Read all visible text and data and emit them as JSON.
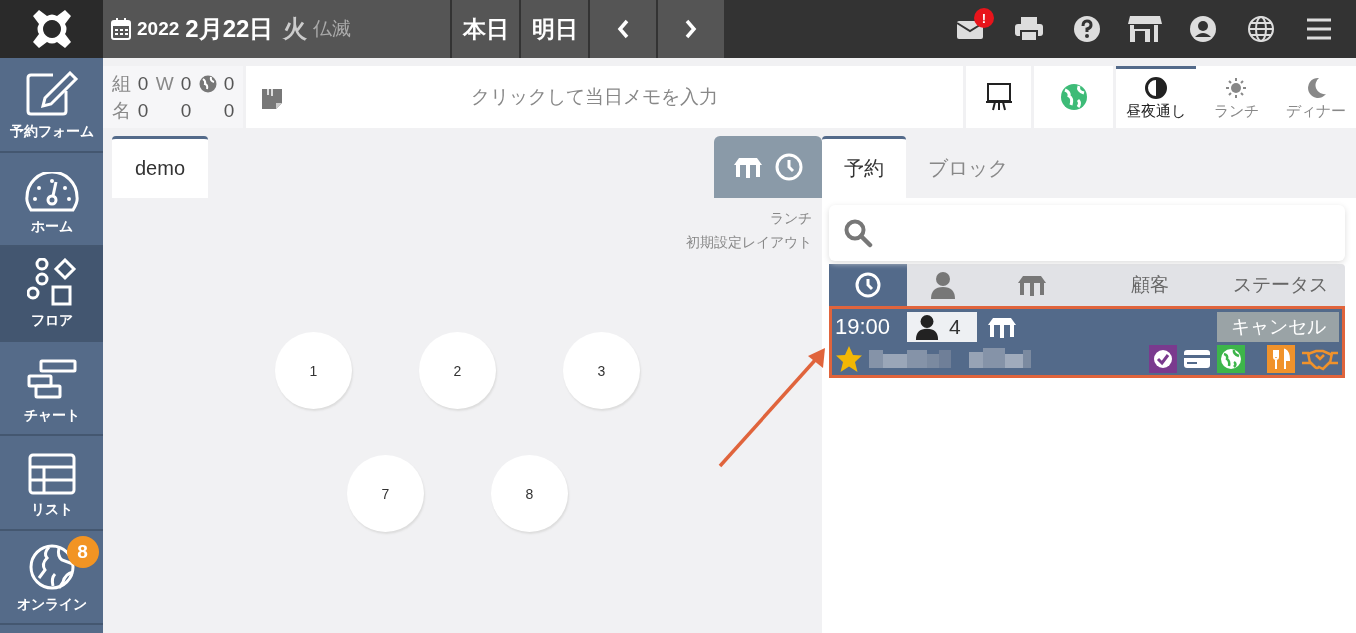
{
  "header": {
    "year": "2022",
    "date": "2月22日",
    "weekday": "火",
    "rokuyo": "仏滅",
    "day_buttons": [
      "本日",
      "明日"
    ],
    "tools": [
      {
        "kind": "mail",
        "badge": "!"
      },
      {
        "kind": "print"
      },
      {
        "kind": "help"
      },
      {
        "kind": "shop"
      },
      {
        "kind": "account"
      },
      {
        "kind": "language"
      },
      {
        "kind": "menu"
      }
    ]
  },
  "sidebar": {
    "items": [
      {
        "label": "予約フォーム",
        "kind": "form",
        "selected": false
      },
      {
        "label": "ホーム",
        "kind": "gauge",
        "selected": false
      },
      {
        "label": "フロア",
        "kind": "floor",
        "selected": true
      },
      {
        "label": "チャート",
        "kind": "chart",
        "selected": false
      },
      {
        "label": "リスト",
        "kind": "list",
        "selected": false
      },
      {
        "label": "オンライン",
        "kind": "online",
        "selected": false,
        "badge": "8"
      }
    ]
  },
  "counts": {
    "w_label": "W",
    "rows": [
      {
        "label": "組",
        "values": [
          "0",
          "0",
          "0"
        ]
      },
      {
        "label": "名",
        "values": [
          "0",
          "0",
          "0"
        ]
      }
    ]
  },
  "memo": {
    "placeholder": "クリックして当日メモを入力"
  },
  "meal_tabs": [
    {
      "label": "昼夜通し",
      "kind": "all",
      "selected": true
    },
    {
      "label": "ランチ",
      "kind": "lunch",
      "selected": false
    },
    {
      "label": "ディナー",
      "kind": "dinner",
      "selected": false
    }
  ],
  "floor": {
    "tabs": [
      {
        "label": "demo",
        "selected": true
      }
    ],
    "period": "ランチ",
    "layout": "初期設定レイアウト",
    "table_rows": [
      [
        "1",
        "2",
        "3"
      ],
      [
        "7",
        "8"
      ]
    ]
  },
  "panel": {
    "tabs": [
      {
        "label": "予約",
        "selected": true
      },
      {
        "label": "ブロック",
        "selected": false
      }
    ],
    "columns": [
      {
        "kind": "time",
        "selected": true
      },
      {
        "kind": "person",
        "selected": false
      },
      {
        "kind": "table",
        "selected": false
      },
      {
        "kind": "text",
        "label": "顧客",
        "selected": false
      },
      {
        "kind": "text",
        "label": "ステータス",
        "selected": false
      }
    ],
    "reservations": [
      {
        "time": "19:00",
        "guests": "4",
        "status": "キャンセル",
        "vip": true,
        "highlighted": true,
        "flags": [
          {
            "kind": "confirmed"
          },
          {
            "kind": "card"
          },
          {
            "kind": "web"
          },
          {
            "kind": "meal"
          },
          {
            "kind": "partner"
          }
        ]
      }
    ]
  }
}
